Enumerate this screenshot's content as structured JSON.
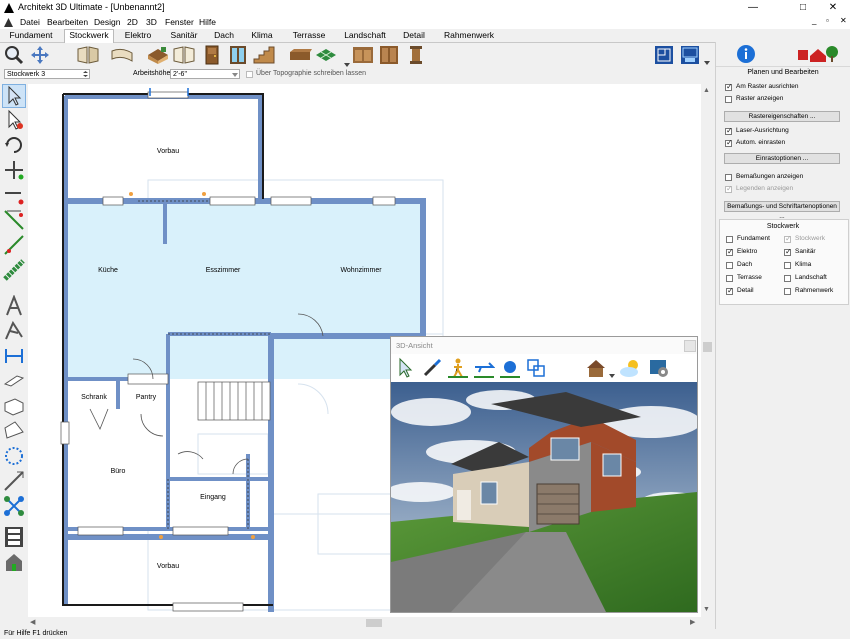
{
  "window": {
    "title": "Architekt 3D Ultimate - [Unbenannt2]",
    "min": "—",
    "max": "□",
    "close": "✕",
    "mdi_min": "_",
    "mdi_restore": "▫",
    "mdi_close": "✕"
  },
  "menu": [
    "Datei",
    "Bearbeiten",
    "Design",
    "2D",
    "3D",
    "Fenster",
    "Hilfe"
  ],
  "tabs": [
    {
      "label": "Fundament"
    },
    {
      "label": "Stockwerk"
    },
    {
      "label": "Elektro"
    },
    {
      "label": "Sanitär"
    },
    {
      "label": "Dach"
    },
    {
      "label": "Klima"
    },
    {
      "label": "Terrasse"
    },
    {
      "label": "Landschaft"
    },
    {
      "label": "Detail"
    },
    {
      "label": "Rahmenwerk"
    }
  ],
  "optionbar": {
    "floor_select": "Stockwerk 3",
    "work_height_label": "Arbeitshöhe:",
    "work_height_value": "2'-6\"",
    "topo_label": "Über Topographie schreiben lassen"
  },
  "rooms": {
    "vorbau_top": "Vorbau",
    "kueche": "Küche",
    "esszimmer": "Esszimmer",
    "wohnzimmer": "Wohnzimmer",
    "schrank": "Schrank",
    "pantry": "Pantry",
    "buero": "Büro",
    "eingang": "Eingang",
    "vorbau_bottom": "Vorbau"
  },
  "view3d": {
    "title": "3D-Ansicht"
  },
  "rightpanel": {
    "section_title": "Planen und Bearbeiten",
    "grid_snap": "Am Raster ausrichten",
    "grid_show": "Raster anzeigen",
    "grid_props_button": "Rastereigenschaften ...",
    "laser_align": "Laser-Ausrichtung",
    "auto_snap": "Autom. einrasten",
    "snap_options_button": "Einrastoptionen ...",
    "show_dims": "Bemaßungen anzeigen",
    "show_legends": "Legenden anzeigen",
    "dims_font_button": "Bemaßungs- und Schriftartenoptionen ...",
    "floor_section_title": "Stockwerk",
    "layers": [
      {
        "label": "Fundament",
        "checked": false,
        "disabled": false
      },
      {
        "label": "Stockwerk",
        "checked": true,
        "disabled": true
      },
      {
        "label": "Elektro",
        "checked": true,
        "disabled": false
      },
      {
        "label": "Sanitär",
        "checked": true,
        "disabled": false
      },
      {
        "label": "Dach",
        "checked": false,
        "disabled": false
      },
      {
        "label": "Klima",
        "checked": false,
        "disabled": false
      },
      {
        "label": "Terrasse",
        "checked": false,
        "disabled": false
      },
      {
        "label": "Landschaft",
        "checked": false,
        "disabled": false
      },
      {
        "label": "Detail",
        "checked": true,
        "disabled": false
      },
      {
        "label": "Rahmenwerk",
        "checked": false,
        "disabled": false
      }
    ]
  },
  "status": {
    "text": "Für Hilfe F1 drücken"
  },
  "colors": {
    "wall": "#6e8fc4",
    "room_fill": "#d6f0fb",
    "accent_blue": "#1c6fd6"
  }
}
